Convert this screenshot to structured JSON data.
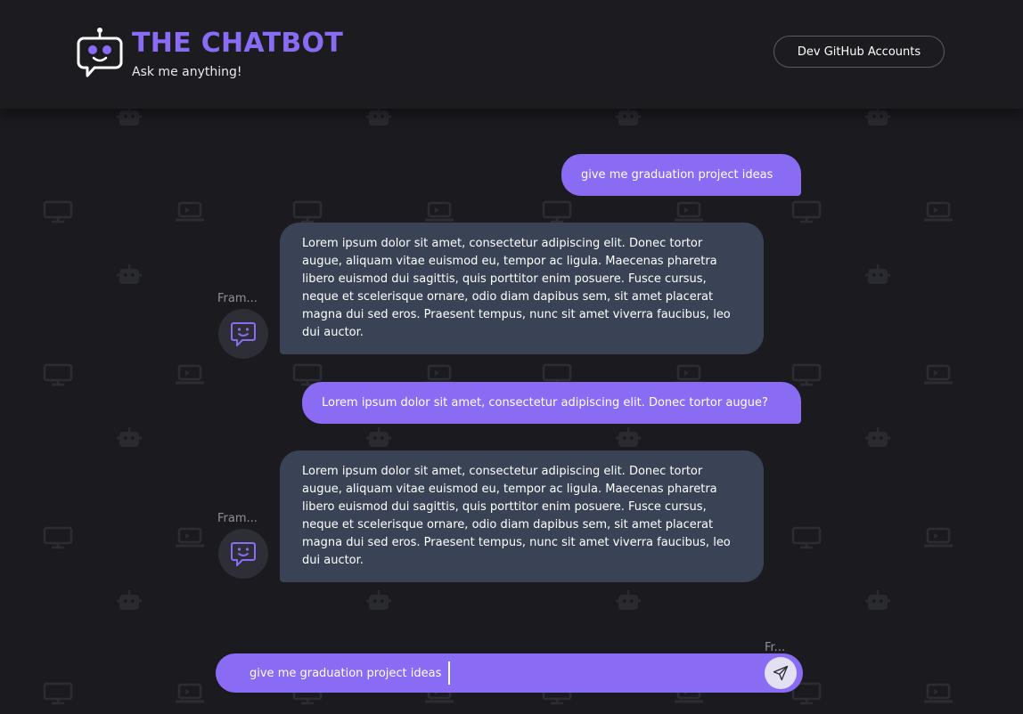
{
  "header": {
    "title": "THE CHATBOT",
    "subtitle": "Ask me anything!",
    "github_button": "Dev GitHub Accounts",
    "logo_icon": "robot-chat-icon"
  },
  "messages": [
    {
      "role": "user",
      "text": "give me graduation project ideas"
    },
    {
      "role": "bot",
      "sender": "Fram...",
      "avatar_icon": "smiley-chat-icon",
      "lines": [
        "Lorem ipsum dolor sit amet, consectetur adipiscing elit. Donec tortor",
        "augue, aliquam vitae euismod eu, tempor ac ligula. Maecenas pharetra",
        "libero euismod dui sagittis, quis porttitor enim posuere. Fusce cursus,",
        "neque et scelerisque ornare, odio diam dapibus sem, sit amet placerat",
        "magna dui sed eros. Praesent tempus, nunc sit amet viverra faucibus, leo",
        "dui auctor."
      ]
    },
    {
      "role": "user",
      "text": "Lorem ipsum dolor sit amet, consectetur adipiscing elit. Donec tortor augue?"
    },
    {
      "role": "bot",
      "sender": "Fram...",
      "avatar_icon": "smiley-chat-icon",
      "lines": [
        "Lorem ipsum dolor sit amet, consectetur adipiscing elit. Donec tortor",
        "augue, aliquam vitae euismod eu, tempor ac ligula. Maecenas pharetra",
        "libero euismod dui sagittis, quis porttitor enim posuere. Fusce cursus,",
        "neque et scelerisque ornare, odio diam dapibus sem, sit amet placerat",
        "magna dui sed eros. Praesent tempus, nunc sit amet viverra faucibus, leo",
        "dui auctor."
      ]
    }
  ],
  "composer": {
    "sender": "Fr...",
    "value": "give me graduation project ideas",
    "send_icon": "send-icon"
  },
  "colors": {
    "accent": "#8a6cf4",
    "bot_bubble": "#3a4356",
    "background": "#1b1b1f",
    "send_button": "#e4e0f4"
  }
}
